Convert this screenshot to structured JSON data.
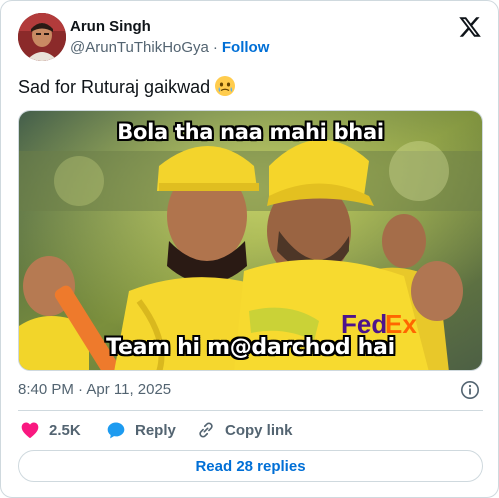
{
  "author": {
    "display_name": "Arun Singh",
    "handle": "@ArunTuThikHoGya",
    "separator": "·",
    "follow_label": "Follow"
  },
  "tweet": {
    "text": "Sad for Ruturaj gaikwad",
    "emoji": "face-holding-back-tears",
    "media": {
      "caption_top": "Bola tha naa mahi bhai",
      "caption_bottom": "Team hi m@darchod hai"
    }
  },
  "meta": {
    "timestamp": "8:40 PM · Apr 11, 2025"
  },
  "actions": {
    "like_count": "2.5K",
    "reply_label": "Reply",
    "copy_label": "Copy link",
    "read_replies_label": "Read 28 replies"
  },
  "colors": {
    "link_blue": "#006fd6",
    "like_pink": "#f91880",
    "reply_blue": "#1d9bf0",
    "secondary_text": "#536471",
    "border": "#cfd9de"
  },
  "icons": [
    "x-logo-icon",
    "info-icon",
    "heart-icon",
    "reply-bubble-icon",
    "link-icon"
  ]
}
